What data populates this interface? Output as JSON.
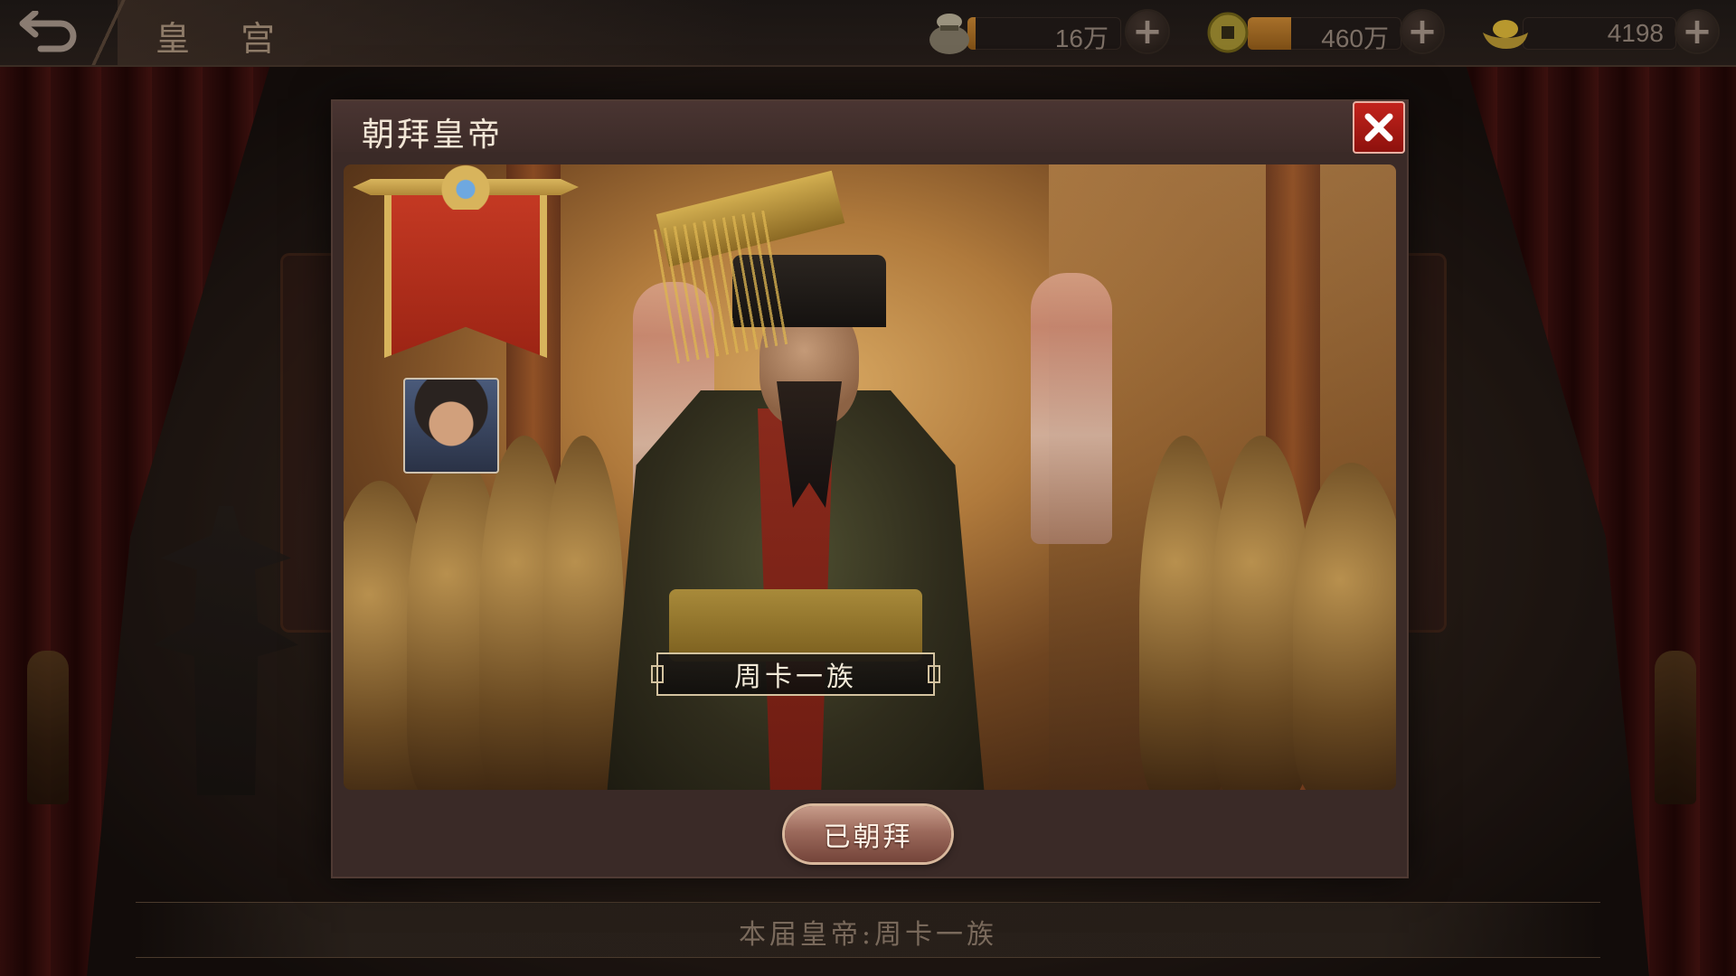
{
  "top_bar": {
    "location_title": "皇 宫",
    "back_icon": "back-arrow-icon",
    "resources": [
      {
        "name": "grain",
        "icon": "grain-sack-icon",
        "value": "16万",
        "fill_fraction": 0.05
      },
      {
        "name": "copper",
        "icon": "copper-coin-icon",
        "value": "460万",
        "fill_fraction": 0.28
      },
      {
        "name": "gold",
        "icon": "gold-ingot-icon",
        "value": "4198",
        "fill_fraction": 0
      }
    ],
    "plus_label": "+"
  },
  "dialog": {
    "title": "朝拜皇帝",
    "close_icon": "close-icon",
    "emperor_name": "周卡一族",
    "action_button": "已朝拜"
  },
  "footer": {
    "current_emperor": "本届皇帝:周卡一族"
  },
  "colors": {
    "close_red": "#c2231c",
    "banner_red": "#c63a24",
    "gold": "#d8b45c",
    "resource_fill": "#a8702a"
  }
}
